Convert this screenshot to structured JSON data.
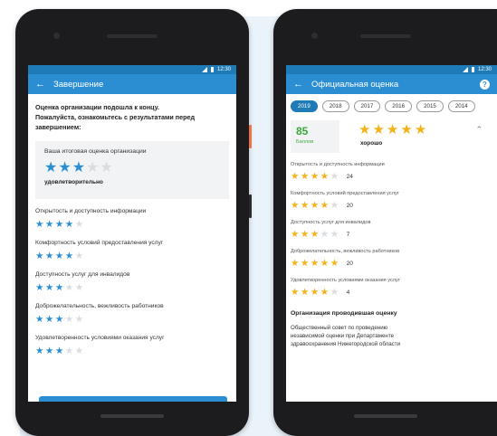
{
  "left": {
    "status": {
      "time": "12:30"
    },
    "appbar": {
      "back": "←",
      "title": "Завершение"
    },
    "intro": [
      "Оценка организации подошла к концу.",
      "Пожалуйста, ознакомьтесь с результатами перед",
      "завершением:"
    ],
    "summary": {
      "caption": "Ваша итоговая оценка организации",
      "stars": 3,
      "max": 5,
      "verdict": "удовлетворительно"
    },
    "criteria": [
      {
        "label": "Открытость и доступность информации",
        "stars": 4
      },
      {
        "label": "Комфортность условий предоставления услуг",
        "stars": 4
      },
      {
        "label": "Доступность услуг для инвалидов",
        "stars": 3
      },
      {
        "label": "Доброжелательность, вежливость работников",
        "stars": 3
      },
      {
        "label": "Удовлетворенность условиями оказания услуг",
        "stars": 3
      }
    ]
  },
  "right": {
    "status": {
      "time": "12:30"
    },
    "appbar": {
      "back": "←",
      "title": "Официальная оценка",
      "help": "?"
    },
    "years": [
      "2019",
      "2018",
      "2017",
      "2016",
      "2015",
      "2014"
    ],
    "active_year": "2019",
    "score": {
      "value": "85",
      "caption": "Баллов",
      "stars": 5,
      "verdict": "хорошо",
      "chevron": "⌃"
    },
    "criteria": [
      {
        "label": "Открытость и доступность информации",
        "stars": 4,
        "count": "24"
      },
      {
        "label": "Комфортность условий предоставления услуг",
        "stars": 4,
        "count": "20"
      },
      {
        "label": "Доступность услуг для инвалидов",
        "stars": 3,
        "count": "7"
      },
      {
        "label": "Доброжелательность, вежливость работников",
        "stars": 5,
        "count": "20"
      },
      {
        "label": "Удовлетворенность условиями оказания услуг",
        "stars": 4,
        "count": "4"
      }
    ],
    "organization": {
      "title": "Организация проводившая оценку",
      "text_lines": [
        "Общественный совет по проведению",
        "независимой оценки при Департаменте",
        "здравоохранения Нижегородской области"
      ]
    }
  },
  "colors": {
    "statusbar": "#1f7ab8",
    "appbar": "#2b8ed3",
    "star_blue": "#2b8ed3",
    "star_gold": "#f3b21a",
    "star_empty": "#d8dde2",
    "score_green": "#3aaa3a",
    "phone_body": "#1c1c1e",
    "side_button": "#e8734a",
    "backdrop": "#eaf2fa"
  },
  "icons": {
    "back": "arrow-left-icon",
    "help": "help-circle-icon",
    "star": "star-icon",
    "chevron": "chevron-up-icon",
    "signal": "signal-icon",
    "battery": "battery-icon"
  }
}
